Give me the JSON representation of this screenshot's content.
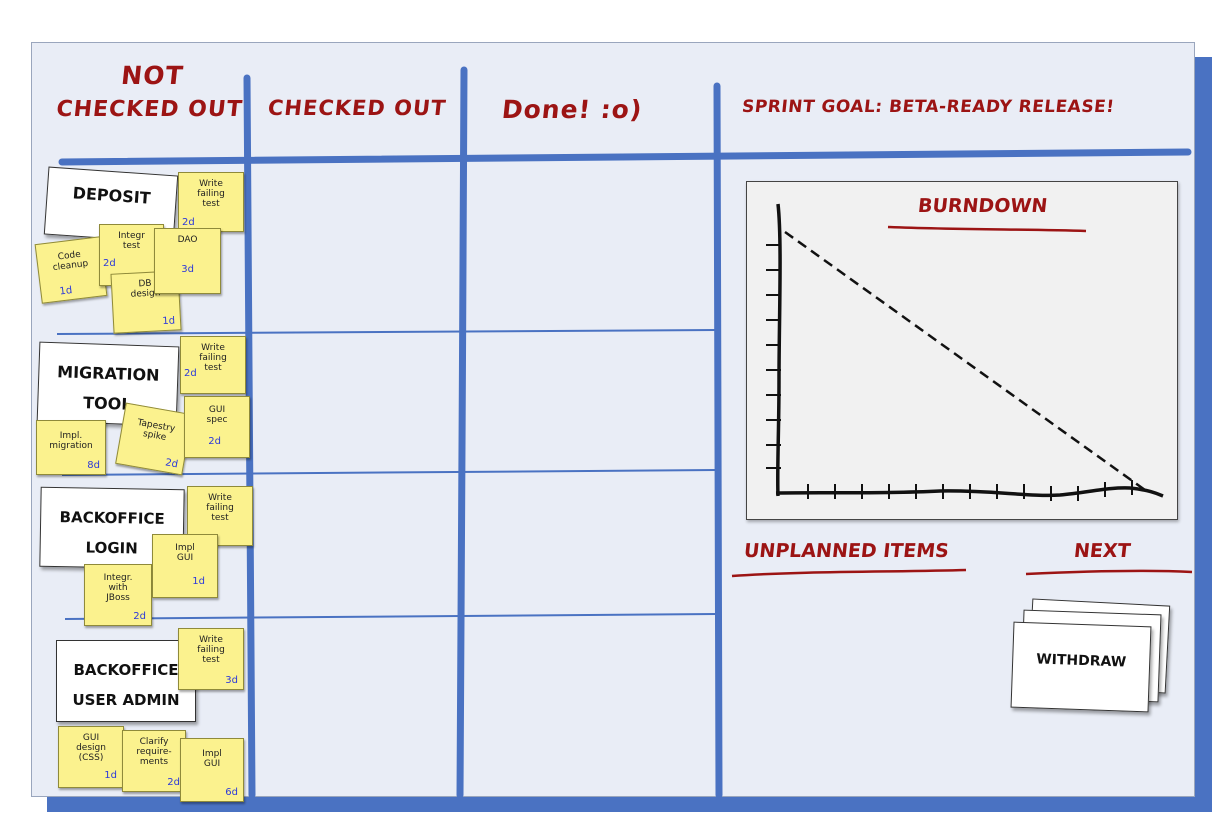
{
  "columns": {
    "not_checked_out": [
      "Not",
      "checked out"
    ],
    "checked_out": "Checked out",
    "done": "Done! :o)",
    "sprint_goal": "Sprint goal: Beta-ready release!"
  },
  "stories": [
    {
      "title": [
        "Deposit"
      ],
      "tasks": [
        {
          "text": "Write\nfailing\ntest",
          "est": "2d"
        },
        {
          "text": "Code\ncleanup",
          "est": "1d"
        },
        {
          "text": "Integr\ntest",
          "est": "2d"
        },
        {
          "text": "DAO",
          "est": "3d"
        },
        {
          "text": "DB\ndesign",
          "est": "1d"
        }
      ]
    },
    {
      "title": [
        "Migration",
        "tool"
      ],
      "tasks": [
        {
          "text": "Write\nfailing\ntest",
          "est": "2d"
        },
        {
          "text": "Impl.\nmigration",
          "est": "8d"
        },
        {
          "text": "Tapestry\nspike",
          "est": "2d"
        },
        {
          "text": "GUI\nspec",
          "est": "2d"
        }
      ]
    },
    {
      "title": [
        "Backoffice",
        "Login"
      ],
      "tasks": [
        {
          "text": "Write\nfailing\ntest",
          "est": ""
        },
        {
          "text": "Impl\nGUI",
          "est": "1d"
        },
        {
          "text": "Integr.\nwith\nJBoss",
          "est": "2d"
        }
      ]
    },
    {
      "title": [
        "Backoffice",
        "User admin"
      ],
      "tasks": [
        {
          "text": "Write\nfailing\ntest",
          "est": "3d"
        },
        {
          "text": "GUI\ndesign\n(CSS)",
          "est": "1d"
        },
        {
          "text": "Clarify\nrequire-\nments",
          "est": "2d"
        },
        {
          "text": "Impl\nGUI",
          "est": "6d"
        }
      ]
    }
  ],
  "burndown": {
    "title": "Burndown"
  },
  "unplanned": {
    "title": "Unplanned items"
  },
  "next": {
    "title": "Next",
    "cards": [
      "Withdraw"
    ]
  },
  "colors": {
    "heading": "#9c1414",
    "lines": "#4a72c2",
    "postit": "#fbf28e",
    "estimate": "#2d3ad9"
  }
}
